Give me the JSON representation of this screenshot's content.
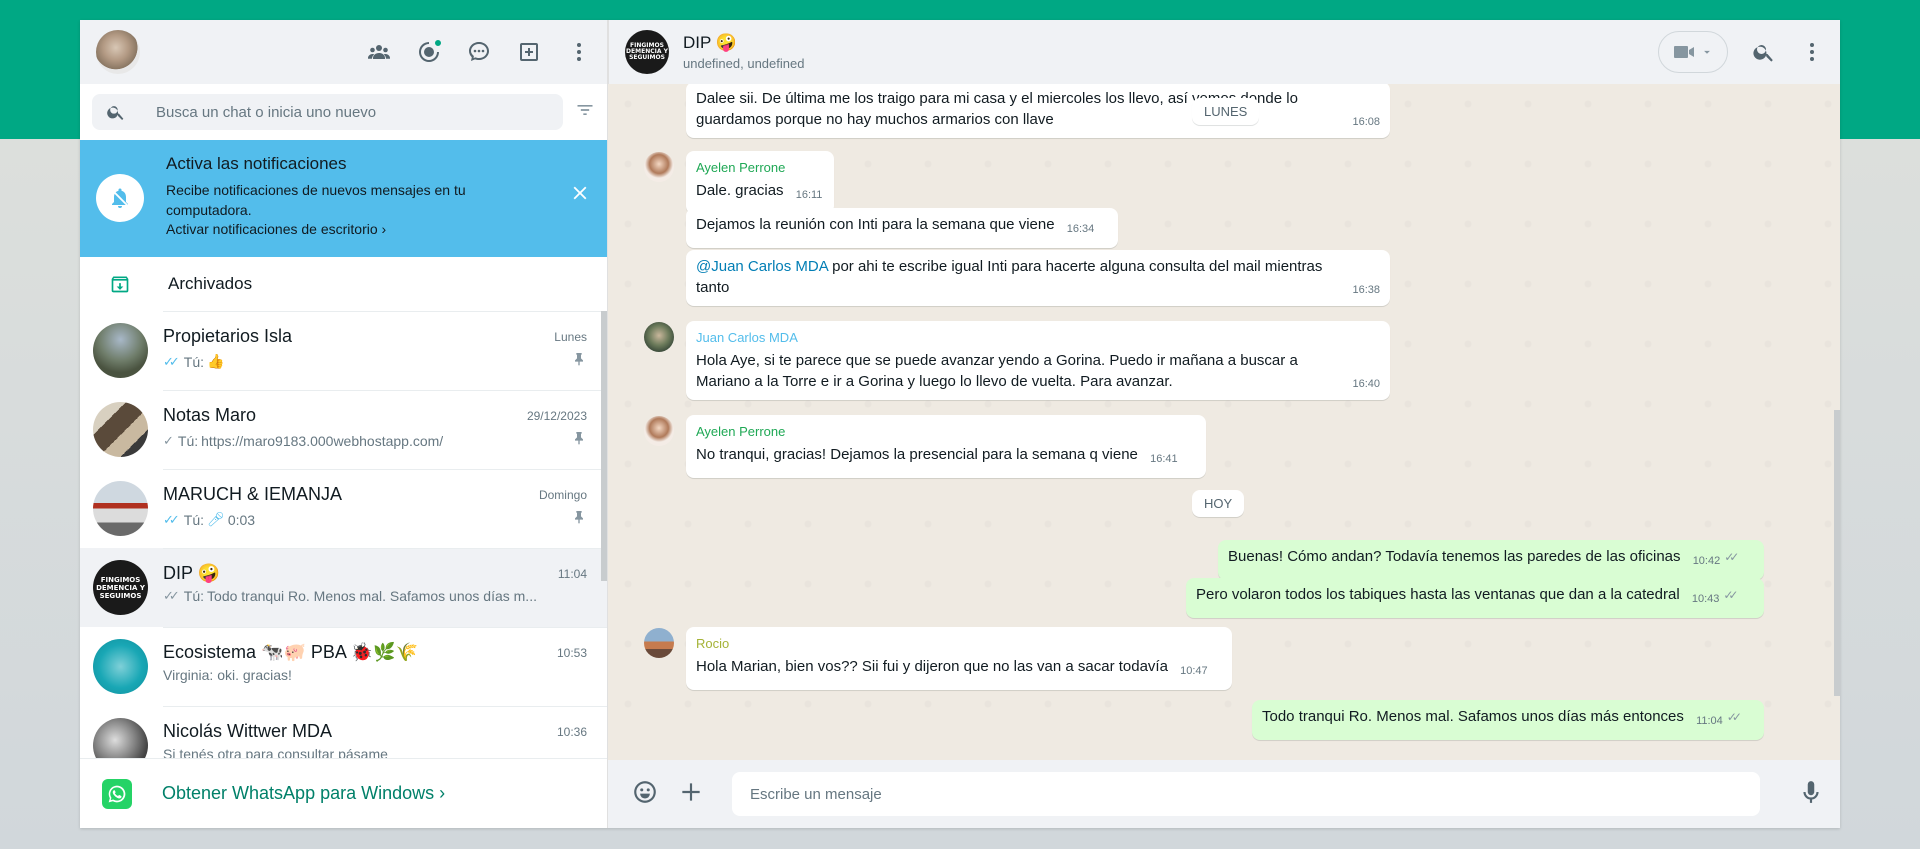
{
  "left": {
    "search": {
      "placeholder": "Busca un chat o inicia uno nuevo"
    },
    "notification": {
      "title": "Activa las notificaciones",
      "description": "Recibe notificaciones de nuevos mensajes en tu computadora.",
      "link": "Activar notificaciones de escritorio ›"
    },
    "archived_label": "Archivados",
    "chats": [
      {
        "name": "Propietarios Isla",
        "time": "Lunes",
        "prefix": "Tú: ",
        "last": "👍",
        "ticks": "✓✓",
        "ticks_color": "#53bdeb",
        "pinned": "pin-icon"
      },
      {
        "name": "Notas Maro",
        "time": "29/12/2023",
        "prefix": "Tú: ",
        "last": "https://maro9183.000webhostapp.com/",
        "ticks": "✓",
        "ticks_color": "#8696a0",
        "pinned": "pin-icon"
      },
      {
        "name": "MARUCH & IEMANJA",
        "time": "Domingo",
        "prefix": "Tú: ",
        "last": "0:03",
        "ticks": "✓✓",
        "ticks_color": "#53bdeb",
        "pinned": "pin-icon"
      },
      {
        "name": "DIP 🤪",
        "time": "11:04",
        "prefix": "Tú: ",
        "last": "Todo tranqui Ro. Menos mal. Safamos unos días m...",
        "ticks": "✓✓",
        "ticks_color": "#8696a0"
      },
      {
        "name": "Ecosistema 🐄🐖 PBA 🐞🌿🌾",
        "time": "10:53",
        "prefix": "",
        "last": "Virginia: oki. gracias!"
      },
      {
        "name": "Nicolás Wittwer MDA",
        "time": "10:36",
        "prefix": "",
        "last": "Si tenés otra para consultar pásame"
      }
    ],
    "get_app": "Obtener WhatsApp para Windows  ›"
  },
  "chat": {
    "title": "DIP 🤪",
    "subtitle": "undefined, undefined",
    "dates": {
      "lunes": "LUNES",
      "hoy": "HOY"
    },
    "messages": [
      {
        "text": "Dalee sii. De última me los traigo para mi casa y el miercoles los llevo, así vemos donde lo guardamos porque no hay muchos armarios con llave",
        "time": "16:08"
      },
      {
        "sender": "Ayelen Perrone",
        "text": "Dale. gracias",
        "time": "16:11"
      },
      {
        "text": "Dejamos la reunión con Inti para la semana que viene",
        "time": "16:34"
      },
      {
        "mention": "@Juan Carlos MDA",
        "text": " por ahi te escribe igual Inti para hacerte alguna consulta del mail mientras tanto",
        "time": "16:38"
      },
      {
        "sender": "Juan Carlos MDA",
        "text": "Hola Aye, si te parece que se puede avanzar yendo a Gorina. Puedo ir mañana a buscar a Mariano a la Torre e ir a Gorina y luego lo llevo de vuelta. Para avanzar.",
        "time": "16:40"
      },
      {
        "sender": "Ayelen Perrone",
        "text": "No tranqui, gracias! Dejamos la presencial para la semana q viene",
        "time": "16:41"
      },
      {
        "text": "Buenas! Cómo andan? Todavía tenemos las paredes de las oficinas",
        "time": "10:42"
      },
      {
        "text": "Pero volaron todos los tabiques hasta las ventanas que dan a la catedral",
        "time": "10:43"
      },
      {
        "sender": "Rocio",
        "text": "Hola Marian, bien vos?? Sii fui y dijeron que no las van a sacar todavía",
        "time": "10:47"
      },
      {
        "text": "Todo tranqui Ro. Menos mal. Safamos unos días más entonces",
        "time": "11:04"
      }
    ],
    "composer_placeholder": "Escribe un mensaje"
  },
  "colors": {
    "brand": "#00a884",
    "notif_bg": "#53bdeb",
    "outgoing": "#d9fdd3",
    "sender_ayelen": "#1fa855",
    "sender_juan": "#53bdeb",
    "sender_rocio": "#a5b337"
  }
}
